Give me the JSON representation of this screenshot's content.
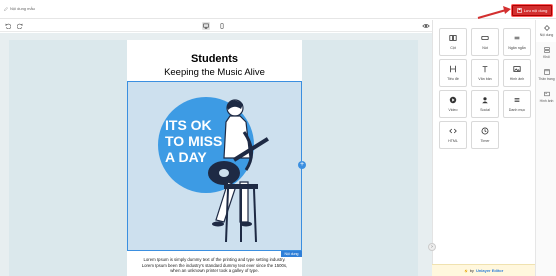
{
  "header": {
    "title": "Nội dung mẫu",
    "save_label": "Lưu nội dung"
  },
  "email": {
    "title": "Students",
    "subtitle": "Keeping the Music Alive",
    "image_text": [
      "ITS OK",
      "TO MISS",
      "A DAY"
    ],
    "image_label": "Nội dung",
    "body_lines": [
      "Lorem Ipsum is simply dummy text of the printing and type setting industry.",
      "Lorem Ipsum been the industry's standard dummy text ever since the 1500s,",
      "when an unknown printer took a galley of type."
    ]
  },
  "tools": [
    {
      "label": "Cột",
      "icon": "columns-icon"
    },
    {
      "label": "Nút",
      "icon": "button-icon"
    },
    {
      "label": "Ngăn ngắn",
      "icon": "divider-icon"
    },
    {
      "label": "Tiêu đề",
      "icon": "heading-icon"
    },
    {
      "label": "Văn bản",
      "icon": "text-icon"
    },
    {
      "label": "Hình ảnh",
      "icon": "image-icon"
    },
    {
      "label": "Video",
      "icon": "video-icon"
    },
    {
      "label": "Social",
      "icon": "social-icon"
    },
    {
      "label": "Danh mục",
      "icon": "menu-icon"
    },
    {
      "label": "HTML",
      "icon": "html-icon"
    },
    {
      "label": "Timer",
      "icon": "timer-icon"
    }
  ],
  "tabs": [
    {
      "label": "Nội dung",
      "icon": "content-icon"
    },
    {
      "label": "Khối",
      "icon": "blocks-icon"
    },
    {
      "label": "Thân trang",
      "icon": "body-icon"
    },
    {
      "label": "Hình ảnh",
      "icon": "images-icon"
    }
  ],
  "powered": {
    "prefix": "by",
    "brand": "Unlayer Editor"
  },
  "colors": {
    "save": "#d32f2f",
    "accent": "#2f7fd8",
    "circle": "#3d9be4",
    "image_bg": "#cde0ee"
  }
}
